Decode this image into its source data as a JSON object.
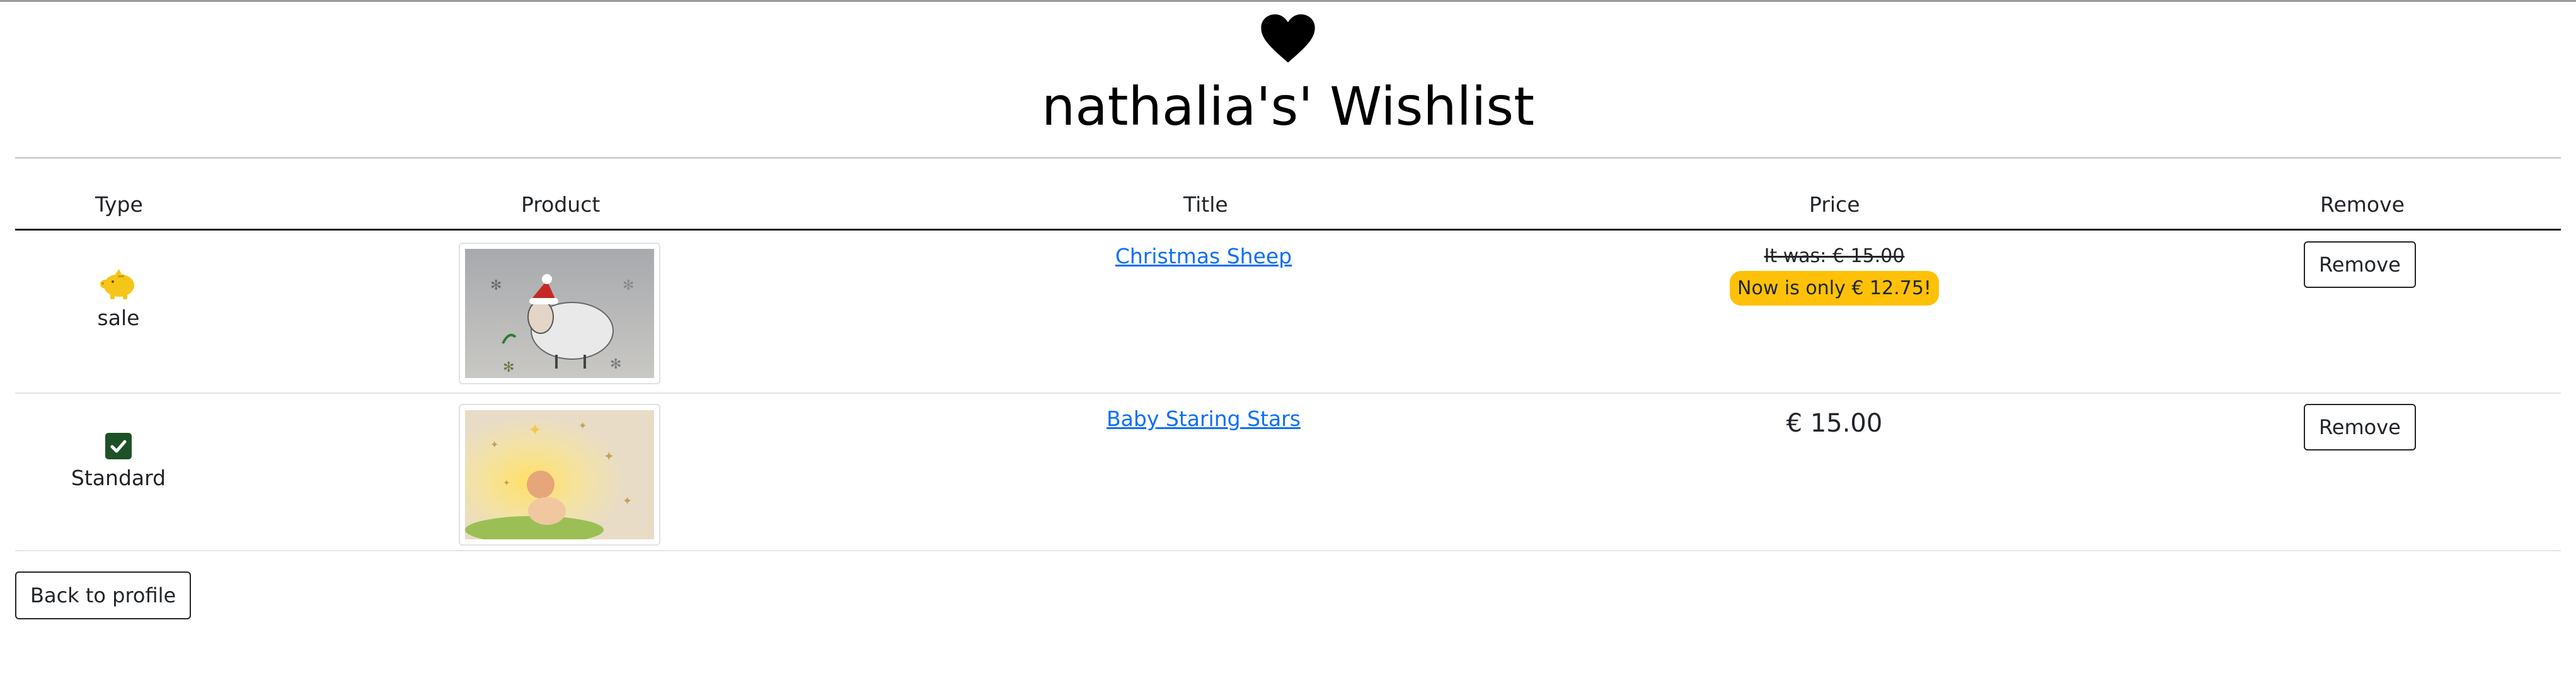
{
  "page": {
    "title": "nathalia's' Wishlist",
    "heart_icon": "heart-icon"
  },
  "table": {
    "headers": {
      "type": "Type",
      "product": "Product",
      "title": "Title",
      "price": "Price",
      "remove": "Remove"
    },
    "rows": [
      {
        "type_icon": "piggy-bank-icon",
        "type_label": "sale",
        "product_image": "christmas-sheep-image",
        "title": "Christmas Sheep",
        "price_was": "It was: € 15.00",
        "price_now": "Now is only € 12.75!",
        "remove_label": "Remove"
      },
      {
        "type_icon": "check-square-icon",
        "type_label": "Standard",
        "product_image": "baby-staring-stars-image",
        "title": "Baby Staring Stars",
        "price": "€ 15.00",
        "remove_label": "Remove"
      }
    ]
  },
  "footer": {
    "back_label": "Back to profile"
  },
  "colors": {
    "sale_badge": "#ffc107",
    "link": "#0d6efd",
    "check_bg": "#1e5128",
    "piggy": "#f5c518"
  }
}
